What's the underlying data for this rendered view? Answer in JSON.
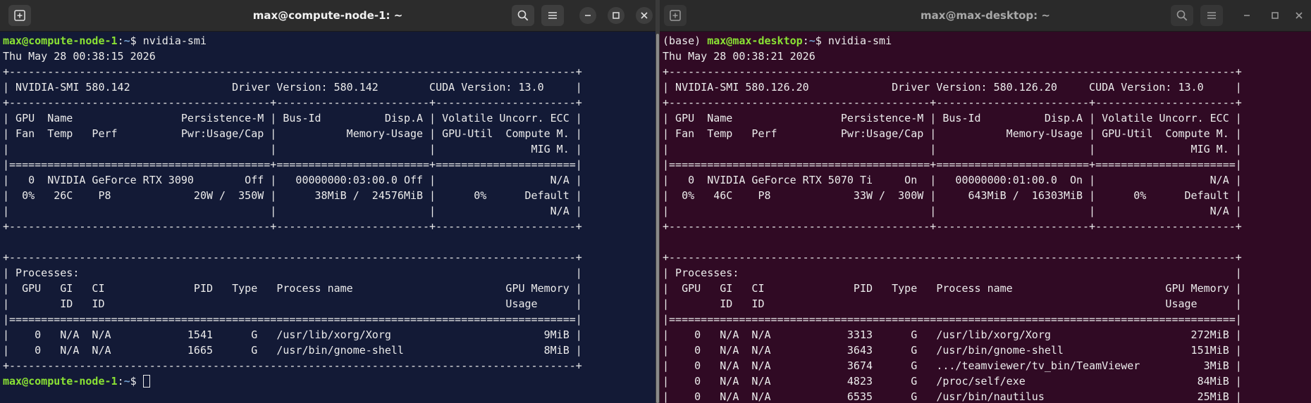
{
  "left": {
    "title": "max@compute-node-1: ~",
    "prompt": {
      "user_host": "max@compute-node-1",
      "path": "~",
      "symbol": "$ ",
      "command": "nvidia-smi"
    },
    "output": [
      "Thu May 28 00:38:15 2026",
      "+-----------------------------------------------------------------------------------------+",
      "| NVIDIA-SMI 580.142                Driver Version: 580.142        CUDA Version: 13.0     |",
      "+-----------------------------------------+------------------------+----------------------+",
      "| GPU  Name                 Persistence-M | Bus-Id          Disp.A | Volatile Uncorr. ECC |",
      "| Fan  Temp   Perf          Pwr:Usage/Cap |           Memory-Usage | GPU-Util  Compute M. |",
      "|                                         |                        |               MIG M. |",
      "|=========================================+========================+======================|",
      "|   0  NVIDIA GeForce RTX 3090        Off |   00000000:03:00.0 Off |                  N/A |",
      "|  0%   26C    P8             20W /  350W |      38MiB /  24576MiB |      0%      Default |",
      "|                                         |                        |                  N/A |",
      "+-----------------------------------------+------------------------+----------------------+",
      "",
      "+-----------------------------------------------------------------------------------------+",
      "| Processes:                                                                              |",
      "|  GPU   GI   CI              PID   Type   Process name                        GPU Memory |",
      "|        ID   ID                                                               Usage      |",
      "|=========================================================================================|",
      "|    0   N/A  N/A            1541      G   /usr/lib/xorg/Xorg                        9MiB |",
      "|    0   N/A  N/A            1665      G   /usr/bin/gnome-shell                      8MiB |",
      "+-----------------------------------------------------------------------------------------+"
    ]
  },
  "right": {
    "title": "max@max-desktop: ~",
    "prompt": {
      "env": "(base) ",
      "user_host": "max@max-desktop",
      "path": "~",
      "symbol": "$ ",
      "command": "nvidia-smi"
    },
    "output": [
      "Thu May 28 00:38:21 2026",
      "+-----------------------------------------------------------------------------------------+",
      "| NVIDIA-SMI 580.126.20             Driver Version: 580.126.20     CUDA Version: 13.0     |",
      "+-----------------------------------------+------------------------+----------------------+",
      "| GPU  Name                 Persistence-M | Bus-Id          Disp.A | Volatile Uncorr. ECC |",
      "| Fan  Temp   Perf          Pwr:Usage/Cap |           Memory-Usage | GPU-Util  Compute M. |",
      "|                                         |                        |               MIG M. |",
      "|=========================================+========================+======================|",
      "|   0  NVIDIA GeForce RTX 5070 Ti     On  |   00000000:01:00.0  On |                  N/A |",
      "|  0%   46C    P8             33W /  300W |     643MiB /  16303MiB |      0%      Default |",
      "|                                         |                        |                  N/A |",
      "+-----------------------------------------+------------------------+----------------------+",
      "",
      "+-----------------------------------------------------------------------------------------+",
      "| Processes:                                                                              |",
      "|  GPU   GI   CI              PID   Type   Process name                        GPU Memory |",
      "|        ID   ID                                                               Usage      |",
      "|=========================================================================================|",
      "|    0   N/A  N/A            3313      G   /usr/lib/xorg/Xorg                      272MiB |",
      "|    0   N/A  N/A            3643      G   /usr/bin/gnome-shell                    151MiB |",
      "|    0   N/A  N/A            3674      G   .../teamviewer/tv_bin/TeamViewer          3MiB |",
      "|    0   N/A  N/A            4823      G   /proc/self/exe                           84MiB |",
      "|    0   N/A  N/A            6535      G   /usr/bin/nautilus                        25MiB |"
    ]
  }
}
